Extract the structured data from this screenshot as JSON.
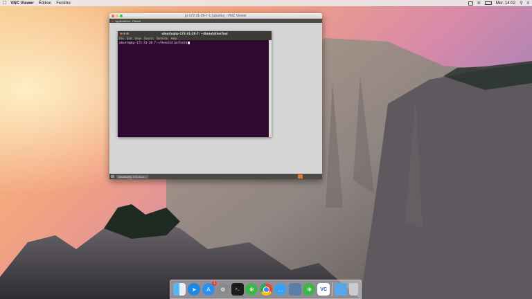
{
  "menubar": {
    "apple": "",
    "app_name": "VNC Viewer",
    "menus": [
      "Édition",
      "Fenêtre"
    ],
    "clock": "Mer. 14:02"
  },
  "vnc_window": {
    "title": "ip-172-31-26-7-1 (ubuntu) - VNC Viewer",
    "gnome_panel": {
      "applications": "Applications",
      "places": "Places"
    },
    "terminal": {
      "title": "ubuntu@ip-172-31-28-7: ~/AnnotationTool",
      "menu": [
        "File",
        "Edit",
        "View",
        "Search",
        "Terminal",
        "Help"
      ],
      "prompt": "ubuntu@ip-172-31-28-7:~/AnnotationTool$"
    },
    "taskbar": {
      "task": "ubuntu@ip-172-31-2..."
    }
  },
  "dock": {
    "items": [
      {
        "name": "finder",
        "color": "#2e8fe6"
      },
      {
        "name": "safari",
        "color": "#1e88e5"
      },
      {
        "name": "app-store",
        "color": "#2b8ff0",
        "badge": "1"
      },
      {
        "name": "system-preferences",
        "color": "#7a7a7a"
      },
      {
        "name": "terminal",
        "color": "#222222"
      },
      {
        "name": "green-app",
        "color": "#3db54a"
      },
      {
        "name": "chrome",
        "color": "#e94235"
      },
      {
        "name": "messages",
        "color": "#3aa0f2"
      },
      {
        "name": "preview",
        "color": "#5a7ea8"
      },
      {
        "name": "green-app-2",
        "color": "#3db54a"
      },
      {
        "name": "vnc-viewer",
        "color": "#ffffff",
        "label": "VC"
      },
      {
        "name": "folder",
        "color": "#5aa7e8"
      },
      {
        "name": "trash",
        "color": "#c9cdd1"
      }
    ]
  }
}
